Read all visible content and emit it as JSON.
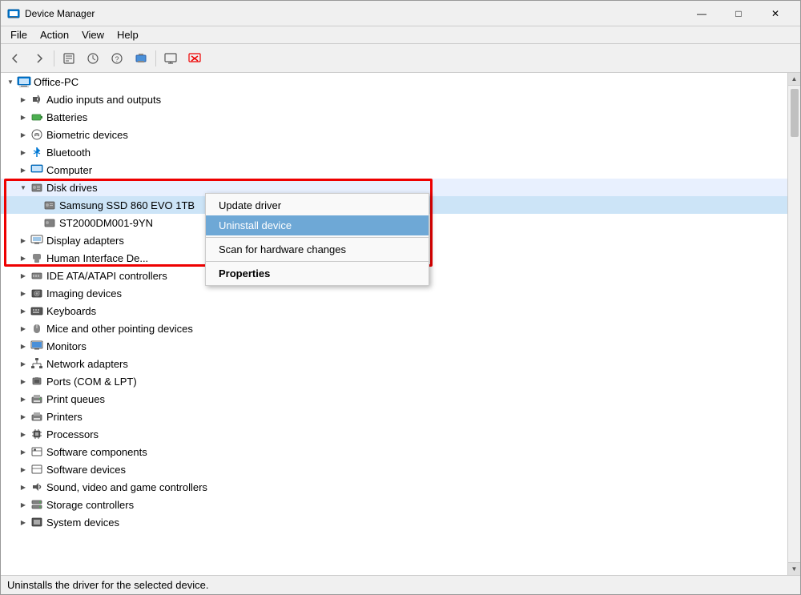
{
  "window": {
    "title": "Device Manager",
    "title_icon": "🖥",
    "controls": {
      "minimize": "—",
      "maximize": "□",
      "close": "✕"
    }
  },
  "menubar": {
    "items": [
      "File",
      "Action",
      "View",
      "Help"
    ]
  },
  "toolbar": {
    "buttons": [
      "←",
      "→",
      "⬜",
      "⬜",
      "❓",
      "⬜",
      "🖥",
      "⬜",
      "✕"
    ]
  },
  "tree": {
    "root": "Office-PC",
    "items": [
      {
        "label": "Audio inputs and outputs",
        "icon": "🔊",
        "indent": 1,
        "expanded": false
      },
      {
        "label": "Batteries",
        "icon": "🔋",
        "indent": 1,
        "expanded": false
      },
      {
        "label": "Biometric devices",
        "icon": "🖐",
        "indent": 1,
        "expanded": false
      },
      {
        "label": "Bluetooth",
        "icon": "🔵",
        "indent": 1,
        "expanded": false
      },
      {
        "label": "Computer",
        "icon": "🖥",
        "indent": 1,
        "expanded": false
      },
      {
        "label": "Disk drives",
        "icon": "💾",
        "indent": 1,
        "expanded": true,
        "highlighted": true
      },
      {
        "label": "Samsung SSD 860 EVO 1TB",
        "icon": "💾",
        "indent": 2,
        "selected": true
      },
      {
        "label": "ST2000DM001-9YN",
        "icon": "💾",
        "indent": 2
      },
      {
        "label": "Display adapters",
        "icon": "🖥",
        "indent": 1,
        "expanded": false
      },
      {
        "label": "Human Interface De...",
        "icon": "🖱",
        "indent": 1,
        "expanded": false
      },
      {
        "label": "IDE ATA/ATAPI controllers",
        "icon": "⚙",
        "indent": 1,
        "expanded": false
      },
      {
        "label": "Imaging devices",
        "icon": "📷",
        "indent": 1,
        "expanded": false
      },
      {
        "label": "Keyboards",
        "icon": "⌨",
        "indent": 1,
        "expanded": false
      },
      {
        "label": "Mice and other pointing devices",
        "icon": "🖱",
        "indent": 1,
        "expanded": false
      },
      {
        "label": "Monitors",
        "icon": "🖥",
        "indent": 1,
        "expanded": false
      },
      {
        "label": "Network adapters",
        "icon": "🌐",
        "indent": 1,
        "expanded": false
      },
      {
        "label": "Ports (COM & LPT)",
        "icon": "🔌",
        "indent": 1,
        "expanded": false
      },
      {
        "label": "Print queues",
        "icon": "🖨",
        "indent": 1,
        "expanded": false
      },
      {
        "label": "Printers",
        "icon": "🖨",
        "indent": 1,
        "expanded": false
      },
      {
        "label": "Processors",
        "icon": "⚙",
        "indent": 1,
        "expanded": false
      },
      {
        "label": "Software components",
        "icon": "⚙",
        "indent": 1,
        "expanded": false
      },
      {
        "label": "Software devices",
        "icon": "⚙",
        "indent": 1,
        "expanded": false
      },
      {
        "label": "Sound, video and game controllers",
        "icon": "🔊",
        "indent": 1,
        "expanded": false
      },
      {
        "label": "Storage controllers",
        "icon": "💾",
        "indent": 1,
        "expanded": false
      },
      {
        "label": "System devices",
        "icon": "⚙",
        "indent": 1,
        "expanded": false
      }
    ]
  },
  "context_menu": {
    "items": [
      {
        "label": "Update driver",
        "type": "normal"
      },
      {
        "label": "Uninstall device",
        "type": "active"
      },
      {
        "label": "Scan for hardware changes",
        "type": "normal"
      },
      {
        "label": "Properties",
        "type": "bold"
      }
    ]
  },
  "status_bar": {
    "text": "Uninstalls the driver for the selected device."
  }
}
